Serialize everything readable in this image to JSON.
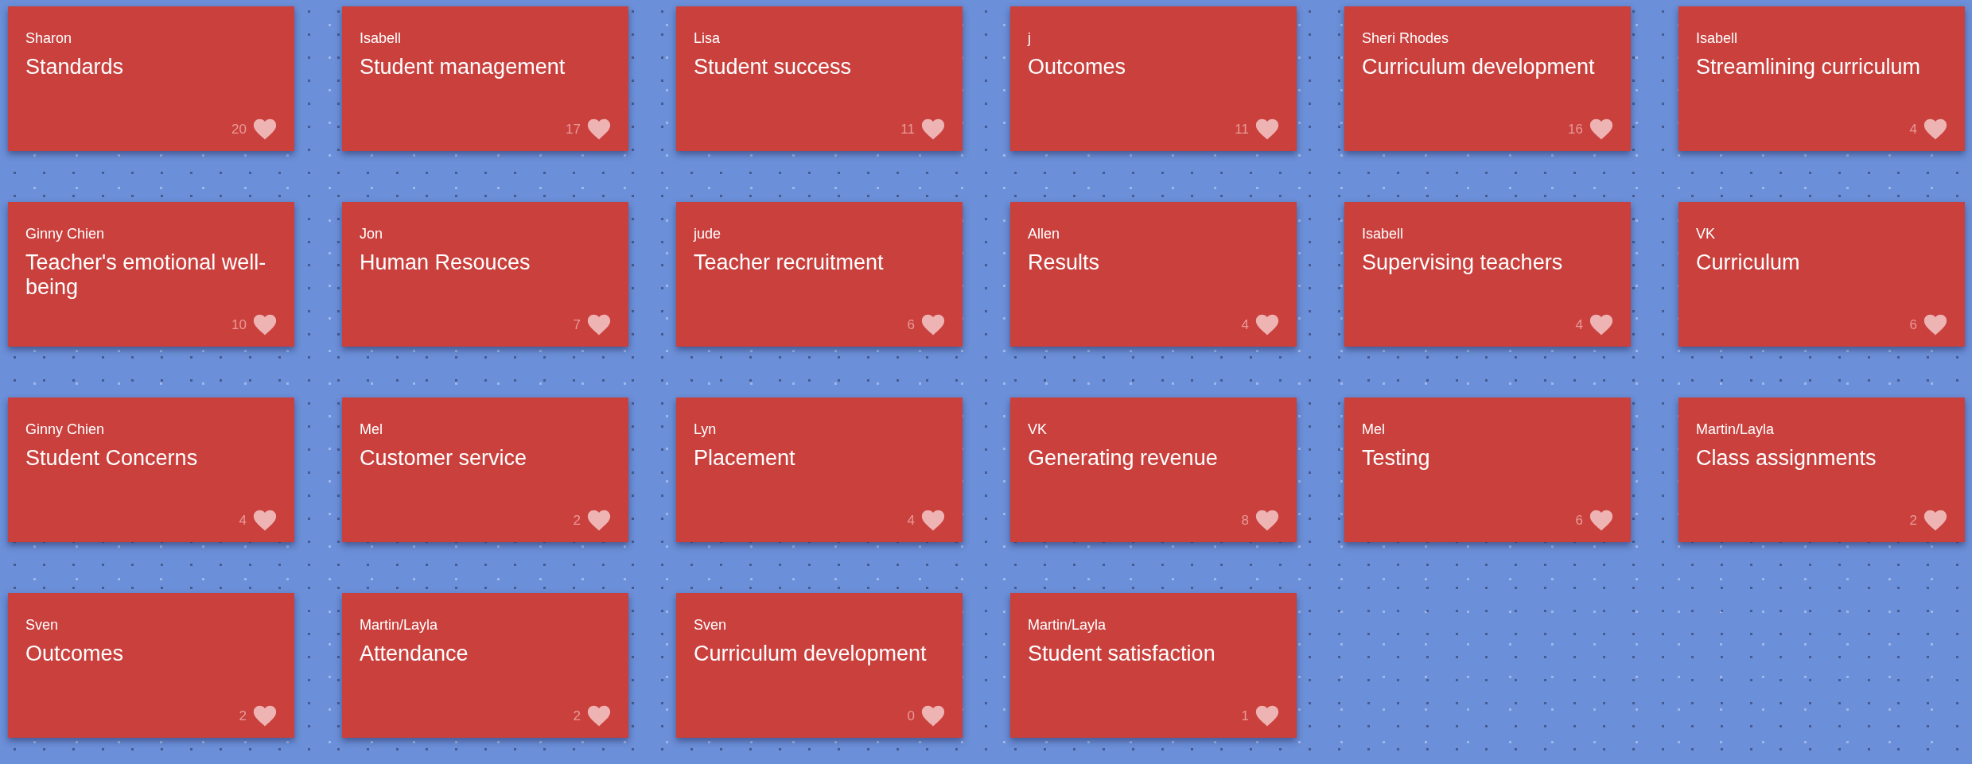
{
  "cards": [
    {
      "author": "Sharon",
      "title": "Standards",
      "likes": "20"
    },
    {
      "author": "Isabell",
      "title": "Student management",
      "likes": "17"
    },
    {
      "author": "Lisa",
      "title": "Student success",
      "likes": "11"
    },
    {
      "author": "j",
      "title": "Outcomes",
      "likes": "11"
    },
    {
      "author": "Sheri Rhodes",
      "title": "Curriculum development",
      "likes": "16"
    },
    {
      "author": "Isabell",
      "title": "Streamlining curriculum",
      "likes": "4"
    },
    {
      "author": "Ginny Chien",
      "title": "Teacher's emotional well-being",
      "likes": "10"
    },
    {
      "author": "Jon",
      "title": "Human Resouces",
      "likes": "7"
    },
    {
      "author": "jude",
      "title": "Teacher recruitment",
      "likes": "6"
    },
    {
      "author": "Allen",
      "title": "Results",
      "likes": "4"
    },
    {
      "author": "Isabell",
      "title": "Supervising teachers",
      "likes": "4"
    },
    {
      "author": "VK",
      "title": "Curriculum",
      "likes": "6"
    },
    {
      "author": "Ginny Chien",
      "title": "Student Concerns",
      "likes": "4"
    },
    {
      "author": "Mel",
      "title": "Customer service",
      "likes": "2"
    },
    {
      "author": "Lyn",
      "title": "Placement",
      "likes": "4"
    },
    {
      "author": "VK",
      "title": "Generating revenue",
      "likes": "8"
    },
    {
      "author": "Mel",
      "title": "Testing",
      "likes": "6"
    },
    {
      "author": "Martin/Layla",
      "title": "Class assignments",
      "likes": "2"
    },
    {
      "author": "Sven",
      "title": "Outcomes",
      "likes": "2"
    },
    {
      "author": "Martin/Layla",
      "title": "Attendance",
      "likes": "2"
    },
    {
      "author": "Sven",
      "title": "Curriculum development",
      "likes": "0"
    },
    {
      "author": "Martin/Layla",
      "title": "Student satisfaction",
      "likes": "1"
    }
  ]
}
